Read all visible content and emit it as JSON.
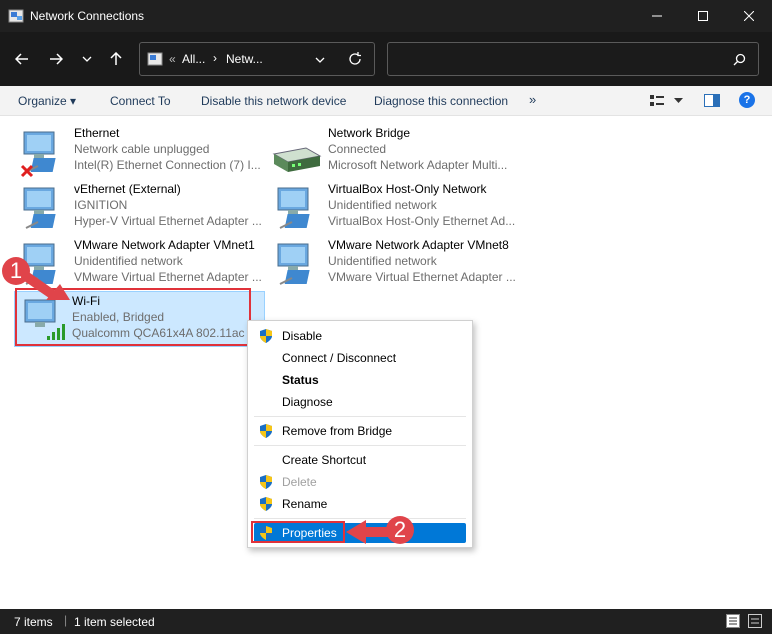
{
  "window": {
    "title": "Network Connections",
    "app_icon": "network-folder-icon"
  },
  "address": {
    "chevrons": "«",
    "crumb1": "All...",
    "sep": "›",
    "crumb2": "Netw..."
  },
  "toolbar": {
    "organize": "Organize ▾",
    "connect_to": "Connect To",
    "disable": "Disable this network device",
    "diagnose": "Diagnose this connection",
    "more": "»"
  },
  "items": [
    {
      "name": "Ethernet",
      "status": "Network cable unplugged",
      "device": "Intel(R) Ethernet Connection (7) I..."
    },
    {
      "name": "Network Bridge",
      "status": "Connected",
      "device": "Microsoft Network Adapter Multi..."
    },
    {
      "name": "vEthernet (External)",
      "status": "IGNITION",
      "device": "Hyper-V Virtual Ethernet Adapter ..."
    },
    {
      "name": "VirtualBox Host-Only Network",
      "status": "Unidentified network",
      "device": "VirtualBox Host-Only Ethernet Ad..."
    },
    {
      "name": "VMware Network Adapter VMnet1",
      "status": "Unidentified network",
      "device": "VMware Virtual Ethernet Adapter ..."
    },
    {
      "name": "VMware Network Adapter VMnet8",
      "status": "Unidentified network",
      "device": "VMware Virtual Ethernet Adapter ..."
    },
    {
      "name": "Wi-Fi",
      "status": "Enabled, Bridged",
      "device": "Qualcomm QCA61x4A 802.11ac ..."
    }
  ],
  "menu": {
    "disable": "Disable",
    "connect": "Connect / Disconnect",
    "status": "Status",
    "diagnose": "Diagnose",
    "remove_bridge": "Remove from Bridge",
    "create_shortcut": "Create Shortcut",
    "delete": "Delete",
    "rename": "Rename",
    "properties": "Properties"
  },
  "annotations": {
    "step1": "1",
    "step2": "2"
  },
  "statusbar": {
    "count": "7 items",
    "selected": "1 item selected"
  },
  "colors": {
    "selection": "#cce8ff",
    "menu_highlight": "#0078d7",
    "annotation_red": "#e0323a"
  }
}
